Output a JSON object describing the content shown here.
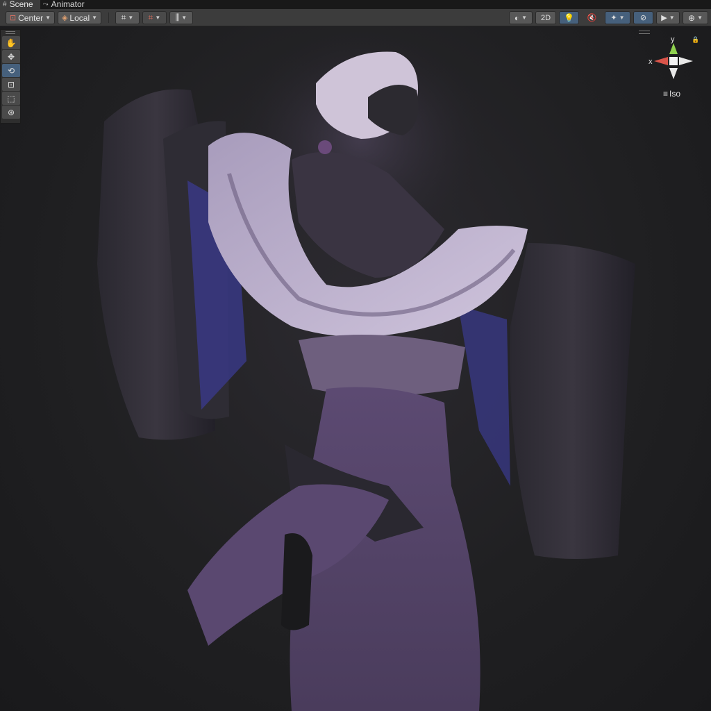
{
  "tabs": [
    {
      "label": "Scene",
      "icon": "grid-icon",
      "active": true
    },
    {
      "label": "Animator",
      "icon": "animator-icon",
      "active": false
    }
  ],
  "toolbar": {
    "pivot_label": "Center",
    "space_label": "Local",
    "mode_2d_label": "2D"
  },
  "tools": [
    "hand-tool",
    "move-tool",
    "rotate-tool",
    "scale-tool",
    "rect-tool",
    "transform-tool"
  ],
  "selected_tool": "rotate-tool",
  "gizmo": {
    "y_label": "y",
    "x_label": "x",
    "projection_label": "Iso"
  },
  "colors": {
    "accent": "#46607c",
    "panel": "#3c3c3c",
    "x_axis": "#d9544a",
    "y_axis": "#8fd14f"
  }
}
